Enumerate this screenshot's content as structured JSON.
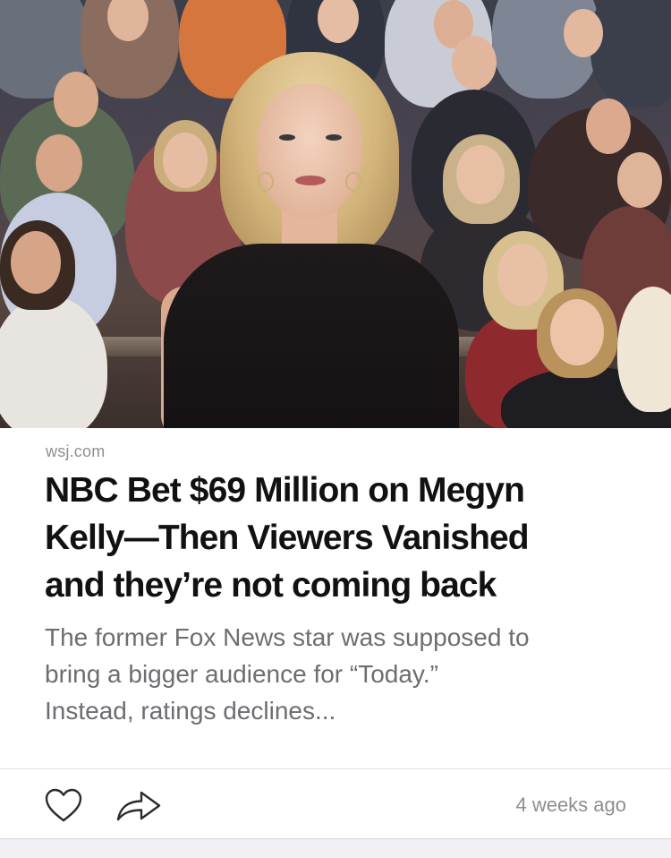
{
  "article": {
    "image_alt": "Megyn Kelly on the Today show set with a studio audience",
    "source": "wsj.com",
    "headline_lines": [
      "NBC Bet $69 Million on Megyn",
      "Kelly—Then Viewers Vanished",
      "and they’re not coming back"
    ],
    "summary_lines": [
      "The former Fox News star was supposed to",
      "bring a bigger audience for “Today.”",
      "Instead, ratings declines..."
    ],
    "timestamp": "4 weeks ago"
  },
  "actions": {
    "like_icon": "heart-outline-icon",
    "share_icon": "share-arrow-icon"
  },
  "colors": {
    "headline": "#111111",
    "summary": "#6d6d72",
    "meta": "#8e8e93",
    "card_bg": "#ffffff",
    "page_bg": "#efeff4"
  }
}
